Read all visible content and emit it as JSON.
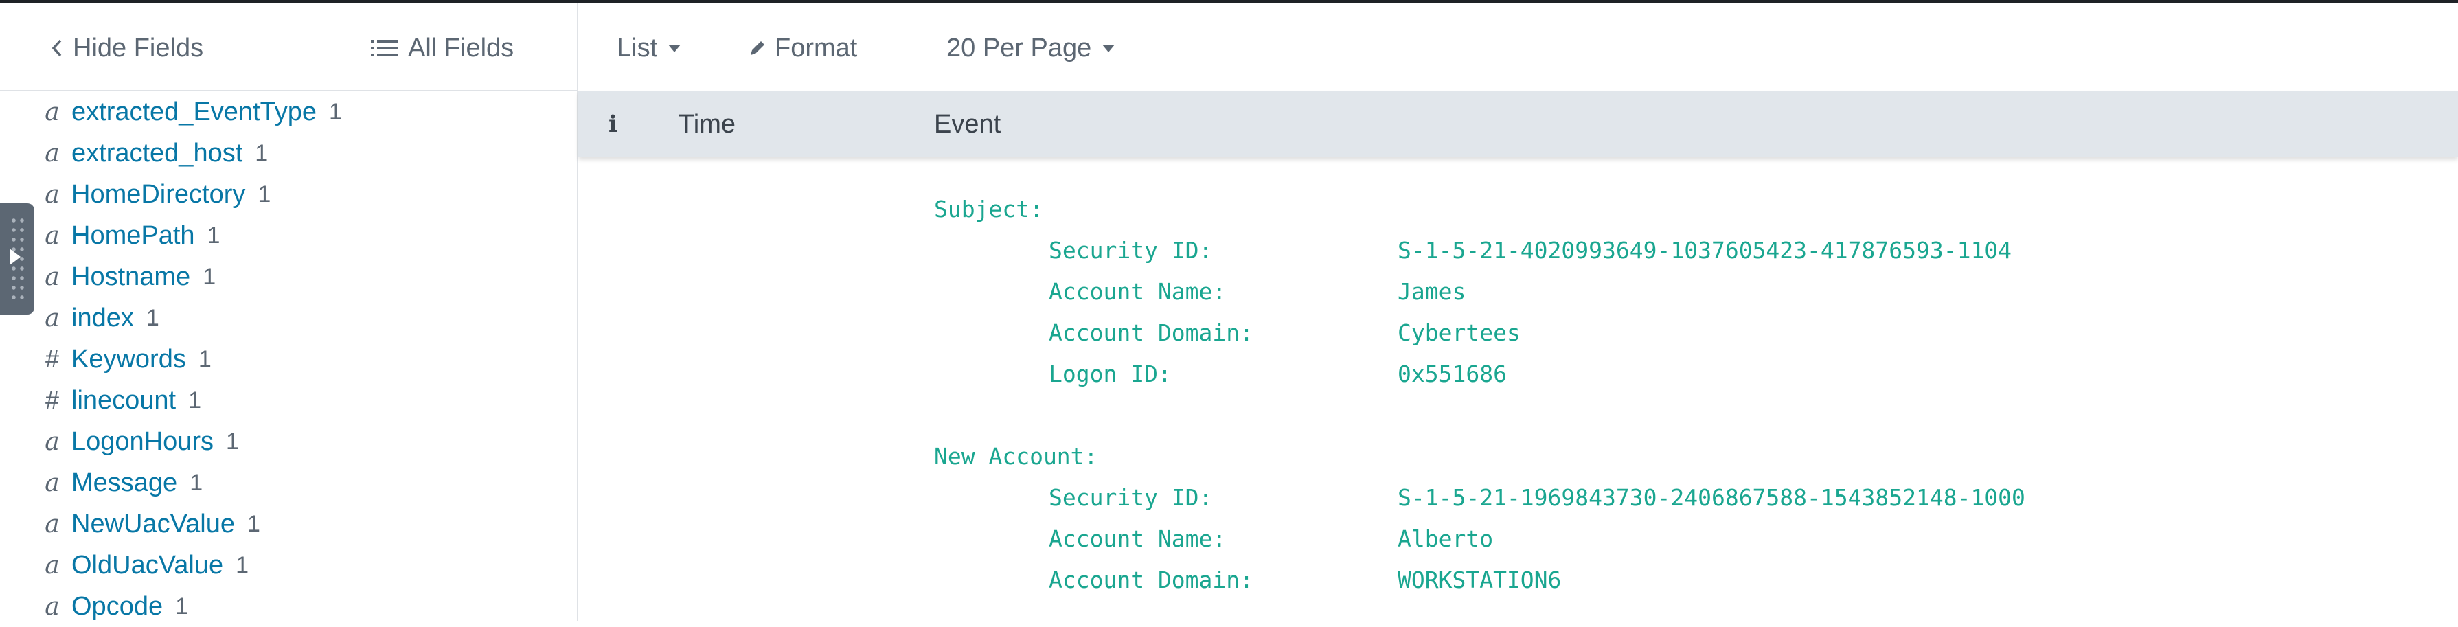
{
  "sidebar": {
    "hide_fields_label": "Hide Fields",
    "all_fields_label": "All Fields",
    "fields": [
      {
        "type": "a",
        "name": "extracted_EventType",
        "count": "1"
      },
      {
        "type": "a",
        "name": "extracted_host",
        "count": "1"
      },
      {
        "type": "a",
        "name": "HomeDirectory",
        "count": "1"
      },
      {
        "type": "a",
        "name": "HomePath",
        "count": "1"
      },
      {
        "type": "a",
        "name": "Hostname",
        "count": "1"
      },
      {
        "type": "a",
        "name": "index",
        "count": "1"
      },
      {
        "type": "#",
        "name": "Keywords",
        "count": "1"
      },
      {
        "type": "#",
        "name": "linecount",
        "count": "1"
      },
      {
        "type": "a",
        "name": "LogonHours",
        "count": "1"
      },
      {
        "type": "a",
        "name": "Message",
        "count": "1"
      },
      {
        "type": "a",
        "name": "NewUacValue",
        "count": "1"
      },
      {
        "type": "a",
        "name": "OldUacValue",
        "count": "1"
      },
      {
        "type": "a",
        "name": "Opcode",
        "count": "1"
      }
    ]
  },
  "toolbar": {
    "list_label": "List",
    "format_label": "Format",
    "per_page_label": "20 Per Page"
  },
  "table": {
    "info_header": "i",
    "time_header": "Time",
    "event_header": "Event"
  },
  "event": {
    "subject": {
      "label": "Subject:",
      "rows": [
        {
          "key": "Security ID:",
          "value": "S-1-5-21-4020993649-1037605423-417876593-1104"
        },
        {
          "key": "Account Name:",
          "value": "James"
        },
        {
          "key": "Account Domain:",
          "value": "Cybertees"
        },
        {
          "key": "Logon ID:",
          "value": "0x551686"
        }
      ]
    },
    "new_account": {
      "label": "New Account:",
      "rows": [
        {
          "key": "Security ID:",
          "value": "S-1-5-21-1969843730-2406867588-1543852148-1000"
        },
        {
          "key": "Account Name:",
          "value": "Alberto"
        },
        {
          "key": "Account Domain:",
          "value": "WORKSTATION6"
        }
      ]
    }
  },
  "colors": {
    "link": "#0877a6",
    "event_text": "#1aa690",
    "header_bg": "#e1e6eb",
    "muted": "#5c6773"
  },
  "icons": [
    "chevron-left-icon",
    "list-icon",
    "caret-down-icon",
    "pencil-icon",
    "info-icon",
    "drag-handle-icon"
  ]
}
